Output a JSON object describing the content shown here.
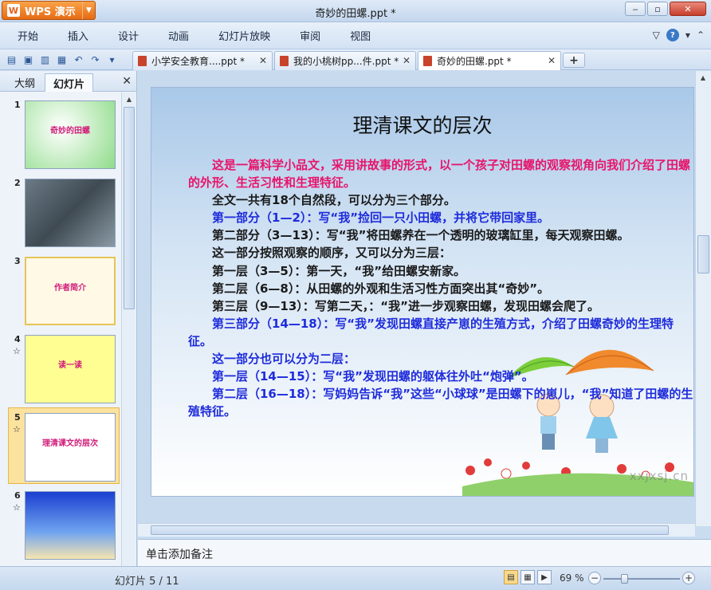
{
  "app": {
    "brand_label": "WPS 演示",
    "brand_logo": "W",
    "window_title": "奇妙的田螺.ppt *"
  },
  "menu": {
    "items": [
      "开始",
      "插入",
      "设计",
      "动画",
      "幻灯片放映",
      "审阅",
      "视图"
    ]
  },
  "doc_tabs": [
    {
      "label": "小学安全教育....ppt *",
      "active": false
    },
    {
      "label": "我的小桃树pp...件.ppt *",
      "active": false
    },
    {
      "label": "奇妙的田螺.ppt *",
      "active": true
    }
  ],
  "left_panel": {
    "tabs": [
      "大纲",
      "幻灯片"
    ],
    "active_tab": "幻灯片",
    "thumbnails": [
      {
        "number": "1",
        "star": "",
        "title": "奇妙的田螺"
      },
      {
        "number": "2",
        "star": "",
        "title": ""
      },
      {
        "number": "3",
        "star": "",
        "title": "作者简介"
      },
      {
        "number": "4",
        "star": "☆",
        "title": "读一读"
      },
      {
        "number": "5",
        "star": "☆",
        "title": "理清课文的层次"
      },
      {
        "number": "6",
        "star": "☆",
        "title": ""
      }
    ],
    "selected_index": 4
  },
  "slide": {
    "title": "理清课文的层次",
    "paragraphs": [
      {
        "text": "这是一篇科学小品文，采用讲故事的形式，以一个孩子对田螺的观察视角向我们介绍了田螺的外形、生活习性和生理特征。",
        "color": "pink",
        "indent": true
      },
      {
        "text": "全文一共有18个自然段，可以分为三个部分。",
        "color": "black",
        "indent": true
      },
      {
        "text": "第一部分（1—2）：写“我”捡回一只小田螺，并将它带回家里。",
        "color": "blue",
        "indent": true
      },
      {
        "text": "第二部分（3—13）：写“我”将田螺养在一个透明的玻璃缸里，每天观察田螺。",
        "color": "black",
        "indent": true
      },
      {
        "text": "这一部分按照观察的顺序，又可以分为三层：",
        "color": "black",
        "indent": true
      },
      {
        "text": "第一层（3—5）：第一天，“我”给田螺安新家。",
        "color": "black",
        "indent": true
      },
      {
        "text": "第二层（6—8）：从田螺的外观和生活习性方面突出其“奇妙”。",
        "color": "black",
        "indent": true
      },
      {
        "text": "第三层（9—13）：写第二天，：“我”进一步观察田螺，发现田螺会爬了。",
        "color": "black",
        "indent": true
      },
      {
        "text": "第三部分（14—18）：写“我”发现田螺直接产崽的生殖方式，介绍了田螺奇妙的生理特征。",
        "color": "blue",
        "indent": true
      },
      {
        "text": "这一部分也可以分为二层：",
        "color": "blue",
        "indent": true
      },
      {
        "text": "第一层（14—15）：写“我”发现田螺的躯体往外吐“炮弹”。",
        "color": "blue",
        "indent": true
      },
      {
        "text": "第二层（16—18）：写妈妈告诉“我”这些“小球球”是田螺下的崽儿，“我”知道了田螺的生殖特征。",
        "color": "blue",
        "indent": true
      }
    ],
    "watermark": "xxjxsj.cn"
  },
  "notes": {
    "placeholder": "单击添加备注"
  },
  "status": {
    "slide_counter": "幻灯片 5 / 11",
    "zoom": "69 %",
    "zoom_fraction": 0.28
  },
  "colors": {
    "pink": "#e8146b",
    "blue": "#1f2cdb",
    "black": "#1a1a1a",
    "accent": "#e56b14"
  }
}
